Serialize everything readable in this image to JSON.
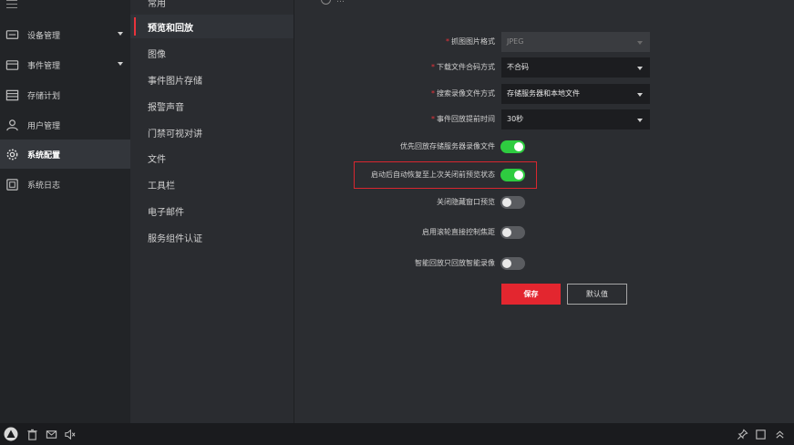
{
  "sidebar": {
    "items": [
      {
        "label": "设备管理",
        "icon": "device-icon",
        "has_submenu": true
      },
      {
        "label": "事件管理",
        "icon": "event-icon",
        "has_submenu": true
      },
      {
        "label": "存储计划",
        "icon": "storage-icon",
        "has_submenu": false
      },
      {
        "label": "用户管理",
        "icon": "user-icon",
        "has_submenu": false
      },
      {
        "label": "系统配置",
        "icon": "gear-icon",
        "has_submenu": false,
        "active": true
      },
      {
        "label": "系统日志",
        "icon": "log-icon",
        "has_submenu": false
      }
    ]
  },
  "submenu": {
    "items": [
      {
        "label": "常用"
      },
      {
        "label": "预览和回放",
        "active": true
      },
      {
        "label": "图像"
      },
      {
        "label": "事件图片存储"
      },
      {
        "label": "报警声音"
      },
      {
        "label": "门禁可视对讲"
      },
      {
        "label": "文件"
      },
      {
        "label": "工具栏"
      },
      {
        "label": "电子邮件"
      },
      {
        "label": "服务组件认证"
      }
    ]
  },
  "form": {
    "top_cut_text": "…",
    "fields": [
      {
        "label": "抓图图片格式",
        "required": true,
        "value": "JPEG",
        "disabled": true
      },
      {
        "label": "下载文件合码方式",
        "required": true,
        "value": "不合码",
        "disabled": false
      },
      {
        "label": "搜索录像文件方式",
        "required": true,
        "value": "存储服务器和本地文件",
        "disabled": false
      },
      {
        "label": "事件回放提前时间",
        "required": true,
        "value": "30秒",
        "disabled": false
      }
    ],
    "toggles": [
      {
        "label": "优先回放存储服务器录像文件",
        "on": true
      },
      {
        "label": "启动后自动恢复至上次关闭前预览状态",
        "on": true,
        "highlighted": true
      },
      {
        "label": "关闭隐藏窗口预览",
        "on": false
      },
      {
        "label": "启用滚轮直接控制焦距",
        "on": false
      },
      {
        "label": "智能回放只回放智能录像",
        "on": false
      }
    ],
    "save_label": "保存",
    "default_label": "默认值"
  },
  "colors": {
    "accent": "#e3262f",
    "toggle_on": "#2ecc40",
    "toggle_off": "#5a5c60",
    "highlight": "#d9262f"
  },
  "bottom_bar": {
    "left_icons": [
      "alert-icon",
      "trash-icon",
      "mail-icon",
      "speaker-icon"
    ],
    "right_icons": [
      "pin-icon",
      "window-icon",
      "expand-up-icon"
    ]
  }
}
